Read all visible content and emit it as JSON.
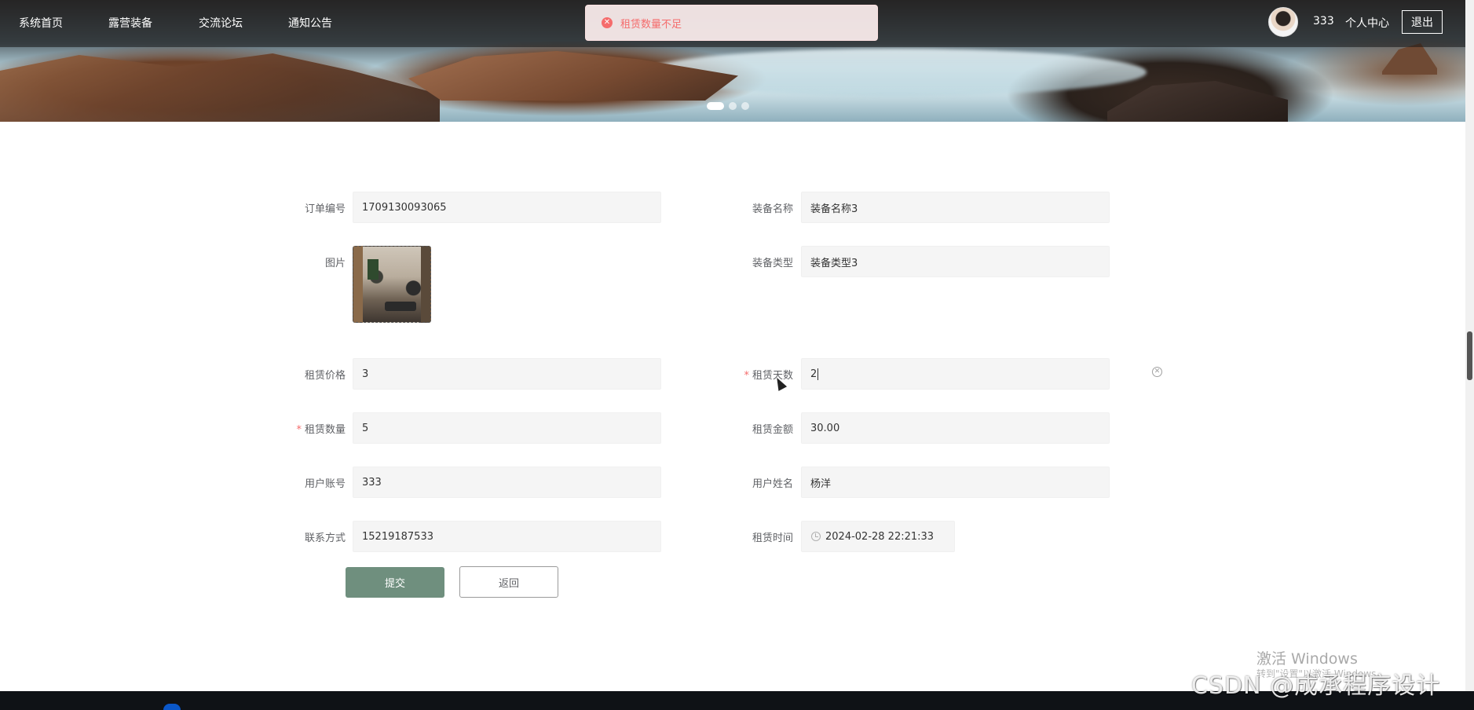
{
  "nav": {
    "items": [
      "系统首页",
      "露营装备",
      "交流论坛",
      "通知公告"
    ],
    "username": "333",
    "center_link": "个人中心",
    "logout": "退出"
  },
  "toast": {
    "icon": "error-circle-icon",
    "message": "租赁数量不足",
    "color": "#f56c6c"
  },
  "carousel": {
    "slides": 3,
    "active_index": 0
  },
  "form": {
    "order_no": {
      "label": "订单编号",
      "value": "1709130093065"
    },
    "equip_name": {
      "label": "装备名称",
      "value": "装备名称3"
    },
    "image": {
      "label": "图片"
    },
    "equip_type": {
      "label": "装备类型",
      "value": "装备类型3"
    },
    "rent_price": {
      "label": "租赁价格",
      "value": "3"
    },
    "rent_days": {
      "label": "租赁天数",
      "value": "2",
      "required": true
    },
    "rent_qty": {
      "label": "租赁数量",
      "value": "5",
      "required": true
    },
    "rent_amount": {
      "label": "租赁金额",
      "value": "30.00"
    },
    "user_account": {
      "label": "用户账号",
      "value": "333"
    },
    "user_name": {
      "label": "用户姓名",
      "value": "杨洋"
    },
    "contact": {
      "label": "联系方式",
      "value": "15219187533"
    },
    "rent_time": {
      "label": "租赁时间",
      "value": "2024-02-28 22:21:33"
    },
    "required_mark": "*"
  },
  "buttons": {
    "submit": "提交",
    "back": "返回"
  },
  "accent_color": "#6f8f7e",
  "watermarks": {
    "windows_title": "激活 Windows",
    "windows_sub": "转到\"设置\"以激活 Windows。",
    "csdn": "CSDN @成承程序设计"
  }
}
